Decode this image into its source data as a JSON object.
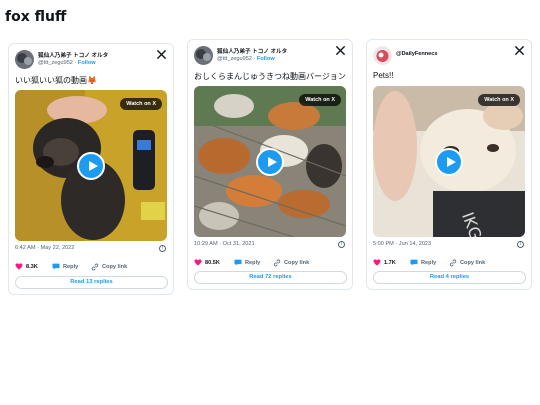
{
  "page": {
    "title": "fox fluff"
  },
  "cards": [
    {
      "author_name": "狐仙人乃弟子 トコノ オルタ",
      "handle": "@ttt_zegu952",
      "follow_label": "Follow",
      "text": "いい狐いい狐の動画🦊",
      "watch_label": "Watch on X",
      "timestamp": "6:42 AM · May 22, 2022",
      "likes": "8.3K",
      "reply_label": "Reply",
      "copy_label": "Copy link",
      "replies_label": "Read 13 replies"
    },
    {
      "author_name": "狐仙人乃弟子 トコノ オルタ",
      "handle": "@ttt_zegu952",
      "follow_label": "Follow",
      "text": "おしくらまんじゅうきつね動画バージョン",
      "watch_label": "Watch on X",
      "timestamp": "10:29 AM · Oct 31, 2021",
      "likes": "80.5K",
      "reply_label": "Reply",
      "copy_label": "Copy link",
      "replies_label": "Read 72 replies"
    },
    {
      "author_name": "@DailyFennecs",
      "text": "Pets!!",
      "watch_label": "Watch on X",
      "timestamp": "5:00 PM · Jun 14, 2023",
      "likes": "1.7K",
      "reply_label": "Reply",
      "copy_label": "Copy link",
      "replies_label": "Read 4 replies"
    }
  ],
  "colors": {
    "accent": "#1d9bf0",
    "like": "#f91880",
    "muted": "#536471"
  },
  "icons": [
    "x-logo-icon",
    "play-icon",
    "heart-icon",
    "reply-bubble-icon",
    "link-icon",
    "info-icon"
  ]
}
